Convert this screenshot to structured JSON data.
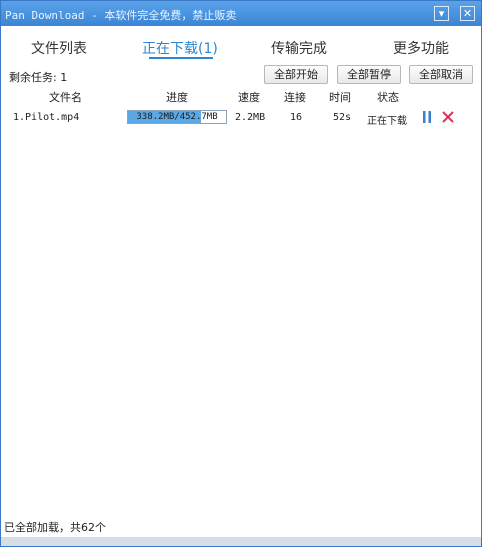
{
  "window": {
    "title": "Pan Download - 本软件完全免费，禁止贩卖",
    "title_color": "#3b84d4"
  },
  "tabs": [
    {
      "label": "文件列表",
      "active": false
    },
    {
      "label": "正在下载(1)",
      "active": true
    },
    {
      "label": "传输完成",
      "active": false
    },
    {
      "label": "更多功能",
      "active": false
    }
  ],
  "toolbar": {
    "remaining_label": "剩余任务: 1",
    "start_all": "全部开始",
    "pause_all": "全部暂停",
    "cancel_all": "全部取消"
  },
  "columns": {
    "filename": "文件名",
    "progress": "进度",
    "speed": "速度",
    "connections": "连接",
    "time": "时间",
    "status": "状态"
  },
  "downloads": [
    {
      "name": "1.Pilot.mp4",
      "progress_text": "338.2MB/452.7MB",
      "progress_fraction": 0.747,
      "speed": "2.2MB",
      "connections": "16",
      "time": "52s",
      "status": "正在下载"
    }
  ],
  "statusbar": {
    "text": "已全部加载，共62个"
  },
  "icons": {
    "minimize": "minimize-icon",
    "close": "close-icon",
    "pause": "pause-icon",
    "cancel": "cancel-x-icon"
  },
  "colors": {
    "accent": "#2c86d4",
    "progress_fill": "#5aa9e6",
    "cancel_red": "#e0335a",
    "pause_blue": "#3a7fcf"
  }
}
